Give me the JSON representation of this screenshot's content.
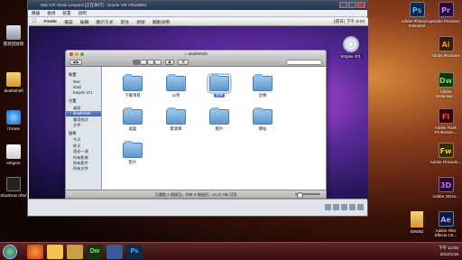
{
  "colors": {
    "accent": "#3875d7",
    "taskbar": "#3a0e0e",
    "vbox_title": "#22324a"
  },
  "desktop_left": [
    {
      "label": "資源回收筒",
      "icon": "recycle-bin-icon"
    },
    {
      "label": "deathshell",
      "icon": "user-folder-icon"
    },
    {
      "label": "iTunes",
      "icon": "itunes-icon"
    },
    {
      "label": "es\\gnre",
      "icon": "document-icon"
    },
    {
      "label": "ShutDow After",
      "icon": "shutdown-app-icon"
    }
  ],
  "desktop_right": [
    {
      "label": "Adobe Photoshop Extended",
      "short": "Ps",
      "color": "#0b2c4a",
      "fg": "#4fb8ff"
    },
    {
      "label": "Adobe Premiere",
      "short": "Pr",
      "color": "#2a0a3e",
      "fg": "#c88cff"
    },
    {
      "label": "Adobe Illustrator",
      "short": "Ai",
      "color": "#3b1a00",
      "fg": "#ff9a1c"
    },
    {
      "label": "Adobe Dreamwe...",
      "short": "Dw",
      "color": "#12360e",
      "fg": "#8fe05a"
    },
    {
      "label": "Adobe Flash Profession...",
      "short": "Fl",
      "color": "#3a0000",
      "fg": "#ff4a3a"
    },
    {
      "label": "Adobe Firework...",
      "short": "Fw",
      "color": "#3a2e00",
      "fg": "#ffd23a"
    },
    {
      "label": "Adobe 3rDes...",
      "short": "3D",
      "color": "#2a0a30",
      "fg": "#d86aff"
    },
    {
      "label": "Adobe After Effects CS...",
      "short": "Ae",
      "color": "#0e1a40",
      "fg": "#b4a0ff"
    }
  ],
  "desktop_misc": {
    "label": "IDR052"
  },
  "vbox": {
    "title": "Mac OS Snow Leopard [正在執行] - Oracle VM VirtualBox",
    "menu": [
      "機器",
      "檢視",
      "裝置",
      "說明"
    ]
  },
  "mac": {
    "menubar": [
      "Finder",
      "檔案",
      "編輯",
      "顯示方式",
      "前往",
      "視窗",
      "輔助說明"
    ],
    "clock": "(週日) 下午 8:03",
    "disc_label": "Empire 371"
  },
  "finder": {
    "title": "deathshell",
    "sidebar": [
      {
        "type": "header",
        "label": "裝置"
      },
      {
        "type": "item",
        "label": "Mac"
      },
      {
        "type": "item",
        "label": "iDisk"
      },
      {
        "type": "item",
        "label": "Empire 371"
      },
      {
        "type": "header",
        "label": "位置"
      },
      {
        "type": "item",
        "label": "桌面"
      },
      {
        "type": "item",
        "label": "deathshell",
        "selected": true
      },
      {
        "type": "item",
        "label": "應用程式"
      },
      {
        "type": "item",
        "label": "文件"
      },
      {
        "type": "header",
        "label": "搜尋"
      },
      {
        "type": "item",
        "label": "今天"
      },
      {
        "type": "item",
        "label": "昨天"
      },
      {
        "type": "item",
        "label": "過去一週"
      },
      {
        "type": "item",
        "label": "所有影像"
      },
      {
        "type": "item",
        "label": "所有影片"
      },
      {
        "type": "item",
        "label": "所有文件"
      }
    ],
    "items": [
      {
        "label": "下載項目",
        "selected": false
      },
      {
        "label": "公用",
        "selected": false
      },
      {
        "label": "文件",
        "selected": true
      },
      {
        "label": "音樂",
        "selected": false
      },
      {
        "label": "桌面",
        "selected": false
      },
      {
        "label": "資源庫",
        "selected": false
      },
      {
        "label": "圖片",
        "selected": false
      },
      {
        "label": "網站",
        "selected": false
      },
      {
        "label": "影片",
        "selected": false
      }
    ],
    "status": "已選取 1 個項目，共有 9 個項目，14.27 GB 可用"
  },
  "tray": {
    "time": "下午 12:03",
    "date": "2012/1/16"
  }
}
